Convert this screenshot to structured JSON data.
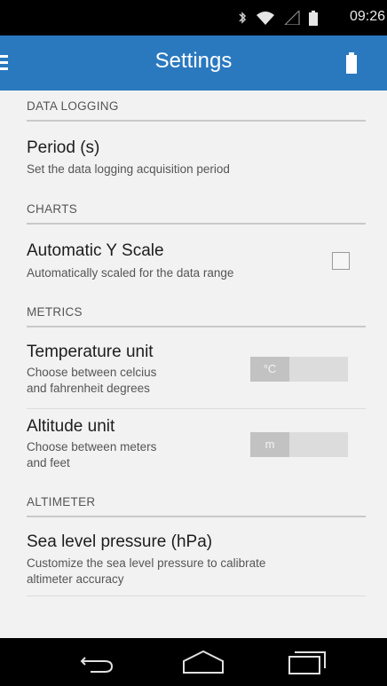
{
  "status_bar": {
    "time": "09:26",
    "icons": [
      "bluetooth-icon",
      "wifi-icon",
      "signal-icon",
      "battery-icon"
    ]
  },
  "app_bar": {
    "title": "Settings",
    "menu_icon": "hamburger-menu-icon",
    "action_icon": "battery-icon",
    "color": "#2a79bf"
  },
  "sections": {
    "data_logging": {
      "header": "DATA LOGGING",
      "period": {
        "title": "Period (s)",
        "summary": "Set the data logging acquisition period"
      }
    },
    "charts": {
      "header": "CHARTS",
      "auto_y_scale": {
        "title": "Automatic Y Scale",
        "summary": "Automatically scaled for the data range",
        "checked": false
      }
    },
    "metrics": {
      "header": "METRICS",
      "temperature_unit": {
        "title": "Temperature unit",
        "summary_line1": "Choose between celcius",
        "summary_line2": "and fahrenheit degrees",
        "value": "°C"
      },
      "altitude_unit": {
        "title": "Altitude unit",
        "summary_line1": "Choose between meters",
        "summary_line2": "and feet",
        "value": "m"
      }
    },
    "altimeter": {
      "header": "ALTIMETER",
      "sea_level_pressure": {
        "title": "Sea level pressure (hPa)",
        "summary_line1": "Customize the sea level pressure to calibrate",
        "summary_line2": "altimeter accuracy"
      }
    }
  },
  "nav_bar": {
    "buttons": [
      "back-icon",
      "home-icon",
      "recent-apps-icon"
    ]
  }
}
